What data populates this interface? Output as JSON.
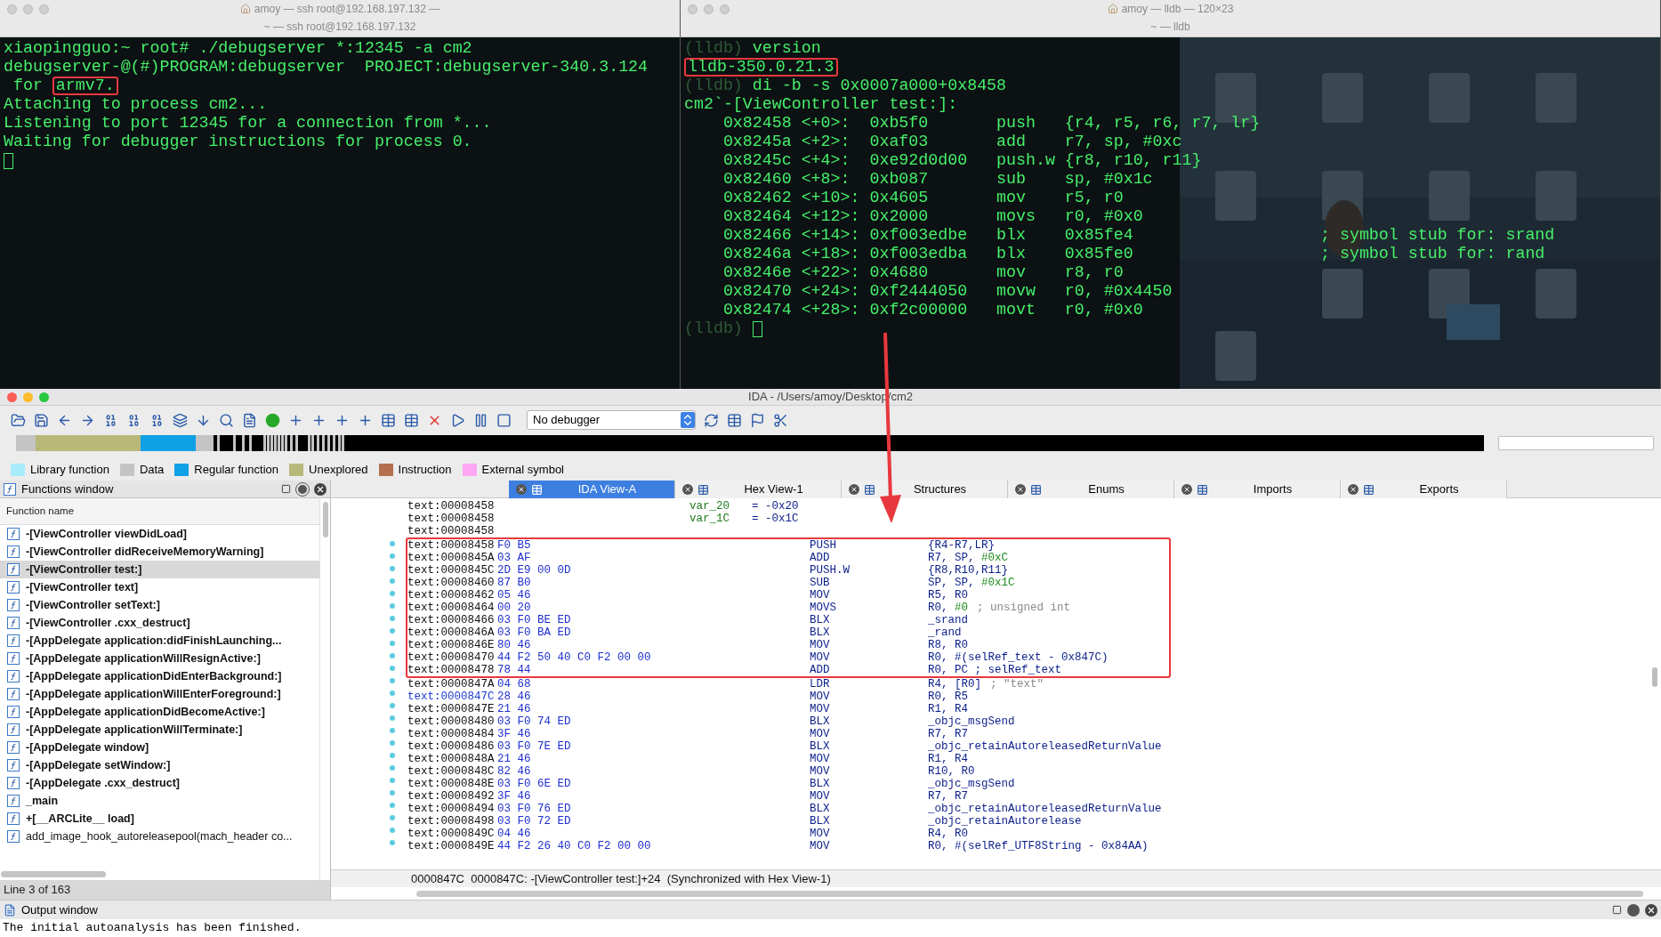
{
  "terminals": [
    {
      "title": "amoy — ssh root@192.168.197.132 —",
      "subtitle": "~ — ssh root@192.168.197.132",
      "lines": [
        {
          "kind": "output",
          "text": "xiaopingguo:~ root# ./debugserver *:12345 -a cm2"
        },
        {
          "kind": "output",
          "text": "debugserver-@(#)PROGRAM:debugserver  PROJECT:debugserver-340.3.124"
        },
        {
          "kind": "boxed",
          "text": " for ",
          "boxed": "armv7."
        },
        {
          "kind": "output",
          "text": "Attaching to process cm2..."
        },
        {
          "kind": "output",
          "text": "Listening to port 12345 for a connection from *..."
        },
        {
          "kind": "output",
          "text": "Waiting for debugger instructions for process 0."
        },
        {
          "kind": "cursor"
        }
      ]
    },
    {
      "title": "amoy — lldb — 120×23",
      "subtitle": "~ — lldb",
      "lines": [
        {
          "kind": "prompt",
          "prompt": "(lldb)",
          "text": "version"
        },
        {
          "kind": "boxed",
          "boxed": "lldb-350.0.21.3"
        },
        {
          "kind": "prompt",
          "prompt": "(lldb)",
          "text": "di -b -s 0x0007a000+0x8458"
        },
        {
          "kind": "output",
          "text": "cm2`-[ViewController test:]:"
        },
        {
          "kind": "output",
          "text": "    0x82458 <+0>:  0xb5f0       push   {r4, r5, r6, r7, lr}"
        },
        {
          "kind": "output",
          "text": "    0x8245a <+2>:  0xaf03       add    r7, sp, #0xc"
        },
        {
          "kind": "output",
          "text": "    0x8245c <+4>:  0xe92d0d00   push.w {r8, r10, r11}"
        },
        {
          "kind": "output",
          "text": "    0x82460 <+8>:  0xb087       sub    sp, #0x1c"
        },
        {
          "kind": "output",
          "text": "    0x82462 <+10>: 0x4605       mov    r5, r0"
        },
        {
          "kind": "output",
          "text": "    0x82464 <+12>: 0x2000       movs   r0, #0x0"
        },
        {
          "kind": "output",
          "text": "    0x82466 <+14>: 0xf003edbe   blx    0x85fe4",
          "comment": "; symbol stub for: srand"
        },
        {
          "kind": "output",
          "text": "    0x8246a <+18>: 0xf003edba   blx    0x85fe0",
          "comment": "; symbol stub for: rand"
        },
        {
          "kind": "output",
          "text": "    0x8246e <+22>: 0x4680       mov    r8, r0"
        },
        {
          "kind": "output",
          "text": "    0x82470 <+24>: 0xf2444050   movw   r0, #0x4450"
        },
        {
          "kind": "output",
          "text": "    0x82474 <+28>: 0xf2c00000   movt   r0, #0x0"
        },
        {
          "kind": "cursor",
          "prompt": "(lldb)"
        }
      ]
    }
  ],
  "ida": {
    "title": "IDA - /Users/amoy/Desktop/cm2",
    "debugger": "No debugger",
    "legend": [
      {
        "label": "Library function",
        "color": "#a8ecfc"
      },
      {
        "label": "Data",
        "color": "#c4c4c4"
      },
      {
        "label": "Regular function",
        "color": "#10a0e6"
      },
      {
        "label": "Unexplored",
        "color": "#b8b87a"
      },
      {
        "label": "Instruction",
        "color": "#b4704e"
      },
      {
        "label": "External symbol",
        "color": "#ffa6f4"
      }
    ],
    "functions_window": {
      "title": "Functions window",
      "column": "Function name",
      "status": "Line 3 of 163",
      "items": [
        {
          "name": "-[ViewController viewDidLoad]",
          "bold": true,
          "selected": false
        },
        {
          "name": "-[ViewController didReceiveMemoryWarning]",
          "bold": true,
          "selected": false
        },
        {
          "name": "-[ViewController test:]",
          "bold": true,
          "selected": true
        },
        {
          "name": "-[ViewController text]",
          "bold": true,
          "selected": false
        },
        {
          "name": "-[ViewController setText:]",
          "bold": true,
          "selected": false
        },
        {
          "name": "-[ViewController .cxx_destruct]",
          "bold": true,
          "selected": false
        },
        {
          "name": "-[AppDelegate application:didFinishLaunching...",
          "bold": true,
          "selected": false
        },
        {
          "name": "-[AppDelegate applicationWillResignActive:]",
          "bold": true,
          "selected": false
        },
        {
          "name": "-[AppDelegate applicationDidEnterBackground:]",
          "bold": true,
          "selected": false
        },
        {
          "name": "-[AppDelegate applicationWillEnterForeground:]",
          "bold": true,
          "selected": false
        },
        {
          "name": "-[AppDelegate applicationDidBecomeActive:]",
          "bold": true,
          "selected": false
        },
        {
          "name": "-[AppDelegate applicationWillTerminate:]",
          "bold": true,
          "selected": false
        },
        {
          "name": "-[AppDelegate window]",
          "bold": true,
          "selected": false
        },
        {
          "name": "-[AppDelegate setWindow:]",
          "bold": true,
          "selected": false
        },
        {
          "name": "-[AppDelegate .cxx_destruct]",
          "bold": true,
          "selected": false
        },
        {
          "name": "_main",
          "bold": true,
          "selected": false
        },
        {
          "name": "+[__ARCLite__ load]",
          "bold": true,
          "selected": false
        },
        {
          "name": "add_image_hook_autoreleasepool(mach_header co...",
          "bold": false,
          "selected": false
        }
      ]
    },
    "tabs": [
      {
        "label": "IDA View-A",
        "selected": true
      },
      {
        "label": "Hex View-1",
        "selected": false
      },
      {
        "label": "Structures",
        "selected": false
      },
      {
        "label": "Enums",
        "selected": false
      },
      {
        "label": "Imports",
        "selected": false
      },
      {
        "label": "Exports",
        "selected": false
      }
    ],
    "listing": [
      {
        "kind": "var",
        "address": "text:00008458",
        "name": "var_20",
        "value": "= -0x20",
        "boxed": false,
        "current": false
      },
      {
        "kind": "var",
        "address": "text:00008458",
        "name": "var_1C",
        "value": "= -0x1C",
        "boxed": false,
        "current": false
      },
      {
        "kind": "blank",
        "address": "text:00008458",
        "boxed": false,
        "current": false
      },
      {
        "kind": "code",
        "address": "text:00008458",
        "bytes": "F0 B5",
        "mnemonic": "PUSH",
        "operands": "{R4-R7,LR}",
        "boxed": true,
        "current": false
      },
      {
        "kind": "code",
        "address": "text:0000845A",
        "bytes": "03 AF",
        "mnemonic": "ADD",
        "operands": "R7, SP, ",
        "immediate": "#0xC",
        "boxed": true,
        "current": false
      },
      {
        "kind": "code",
        "address": "text:0000845C",
        "bytes": "2D E9 00 0D",
        "mnemonic": "PUSH.W",
        "operands": "{R8,R10,R11}",
        "boxed": true,
        "current": false
      },
      {
        "kind": "code",
        "address": "text:00008460",
        "bytes": "87 B0",
        "mnemonic": "SUB",
        "operands": "SP, SP, ",
        "immediate": "#0x1C",
        "boxed": true,
        "current": false
      },
      {
        "kind": "code",
        "address": "text:00008462",
        "bytes": "05 46",
        "mnemonic": "MOV",
        "operands": "R5, R0",
        "boxed": true,
        "current": false
      },
      {
        "kind": "code",
        "address": "text:00008464",
        "bytes": "00 20",
        "mnemonic": "MOVS",
        "operands": "R0, ",
        "immediate": "#0",
        "comment": "; unsigned int",
        "boxed": true,
        "current": false
      },
      {
        "kind": "code",
        "address": "text:00008466",
        "bytes": "03 F0 BE ED",
        "mnemonic": "BLX",
        "operands": "_srand",
        "boxed": true,
        "current": false
      },
      {
        "kind": "code",
        "address": "text:0000846A",
        "bytes": "03 F0 BA ED",
        "mnemonic": "BLX",
        "operands": "_rand",
        "boxed": true,
        "current": false
      },
      {
        "kind": "code",
        "address": "text:0000846E",
        "bytes": "80 46",
        "mnemonic": "MOV",
        "operands": "R8, R0",
        "boxed": true,
        "current": false
      },
      {
        "kind": "code",
        "address": "text:00008470",
        "bytes": "44 F2 50 40 C0 F2 00 00",
        "mnemonic": "MOV",
        "operands": "R0, #(selRef_text - 0x847C)",
        "boxed": true,
        "current": false
      },
      {
        "kind": "code",
        "address": "text:00008478",
        "bytes": "78 44",
        "mnemonic": "ADD",
        "operands": "R0, PC ; selRef_text",
        "boxed": true,
        "current": false
      },
      {
        "kind": "code",
        "address": "text:0000847A",
        "bytes": "04 68",
        "mnemonic": "LDR",
        "operands": "R4, [R0]",
        "comment": "; \"text\"",
        "boxed": false,
        "current": false
      },
      {
        "kind": "code",
        "address": "text:0000847C",
        "bytes": "28 46",
        "mnemonic": "MOV",
        "operands": "R0, R5",
        "boxed": false,
        "current": true
      },
      {
        "kind": "code",
        "address": "text:0000847E",
        "bytes": "21 46",
        "mnemonic": "MOV",
        "operands": "R1, R4",
        "boxed": false,
        "current": false
      },
      {
        "kind": "code",
        "address": "text:00008480",
        "bytes": "03 F0 74 ED",
        "mnemonic": "BLX",
        "operands": "_objc_msgSend",
        "boxed": false,
        "current": false
      },
      {
        "kind": "code",
        "address": "text:00008484",
        "bytes": "3F 46",
        "mnemonic": "MOV",
        "operands": "R7, R7",
        "boxed": false,
        "current": false
      },
      {
        "kind": "code",
        "address": "text:00008486",
        "bytes": "03 F0 7E ED",
        "mnemonic": "BLX",
        "operands": "_objc_retainAutoreleasedReturnValue",
        "boxed": false,
        "current": false
      },
      {
        "kind": "code",
        "address": "text:0000848A",
        "bytes": "21 46",
        "mnemonic": "MOV",
        "operands": "R1, R4",
        "boxed": false,
        "current": false
      },
      {
        "kind": "code",
        "address": "text:0000848C",
        "bytes": "82 46",
        "mnemonic": "MOV",
        "operands": "R10, R0",
        "boxed": false,
        "current": false
      },
      {
        "kind": "code",
        "address": "text:0000848E",
        "bytes": "03 F0 6E ED",
        "mnemonic": "BLX",
        "operands": "_objc_msgSend",
        "boxed": false,
        "current": false
      },
      {
        "kind": "code",
        "address": "text:00008492",
        "bytes": "3F 46",
        "mnemonic": "MOV",
        "operands": "R7, R7",
        "boxed": false,
        "current": false
      },
      {
        "kind": "code",
        "address": "text:00008494",
        "bytes": "03 F0 76 ED",
        "mnemonic": "BLX",
        "operands": "_objc_retainAutoreleasedReturnValue",
        "boxed": false,
        "current": false
      },
      {
        "kind": "code",
        "address": "text:00008498",
        "bytes": "03 F0 72 ED",
        "mnemonic": "BLX",
        "operands": "_objc_retainAutorelease",
        "boxed": false,
        "current": false
      },
      {
        "kind": "code",
        "address": "text:0000849C",
        "bytes": "04 46",
        "mnemonic": "MOV",
        "operands": "R4, R0",
        "boxed": false,
        "current": false
      },
      {
        "kind": "code",
        "address": "text:0000849E",
        "bytes": "44 F2 26 40 C0 F2 00 00",
        "mnemonic": "MOV",
        "operands": "R0, #(selRef_UTF8String - 0x84AA)",
        "boxed": false,
        "current": false
      }
    ],
    "listing_status": "0000847C  0000847C: -[ViewController test:]+24  (Synchronized with Hex View-1)",
    "output_window": {
      "title": "Output window",
      "text": "The initial autoanalysis has been finished."
    }
  }
}
